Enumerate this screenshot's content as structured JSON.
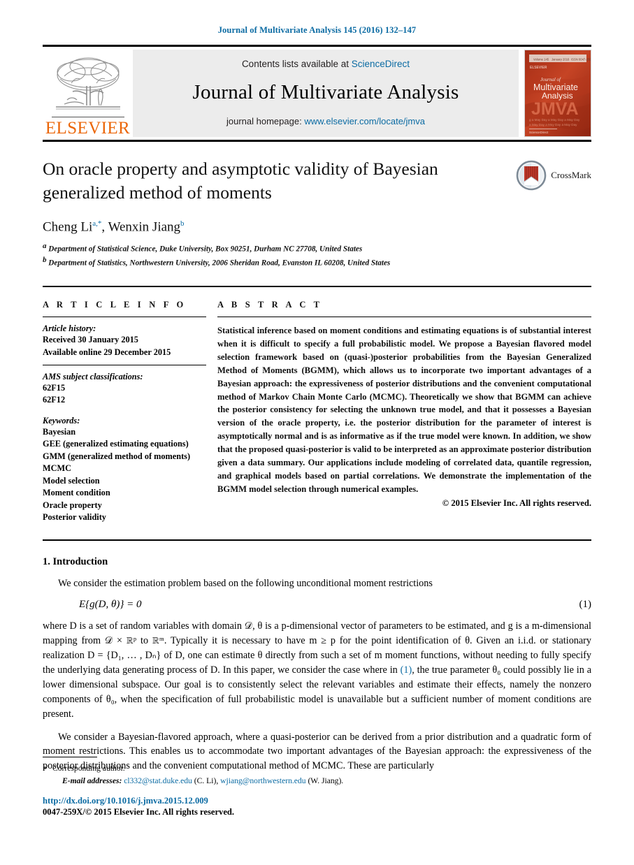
{
  "running_head": "Journal of Multivariate Analysis 145 (2016) 132–147",
  "masthead": {
    "publisher_name": "ELSEVIER",
    "contents_prefix": "Contents lists available at ",
    "contents_link": "ScienceDirect",
    "journal_title": "Journal of Multivariate Analysis",
    "homepage_prefix": "journal homepage: ",
    "homepage_link": "www.elsevier.com/locate/jmva",
    "cover": {
      "line1": "Journal of",
      "line2": "Multivariate",
      "line3": "Analysis",
      "line4": "JMVA",
      "top_left": "Volume 145",
      "top_mid": "January 2016",
      "top_right": "ISSN 0047-259X",
      "bottom": "ScienceDirect"
    }
  },
  "title": "On oracle property and asymptotic validity of Bayesian generalized method of moments",
  "authors": {
    "author1_name": "Cheng Li",
    "author1_sup": "a,*",
    "separator": ", ",
    "author2_name": "Wenxin Jiang",
    "author2_sup": "b"
  },
  "affiliations": [
    {
      "marker": "a",
      "text": "Department of Statistical Science, Duke University, Box 90251, Durham NC 27708, United States"
    },
    {
      "marker": "b",
      "text": "Department of Statistics, Northwestern University, 2006 Sheridan Road, Evanston IL 60208, United States"
    }
  ],
  "crossmark_label": "CrossMark",
  "article_info": {
    "heading": "A R T I C L E   I N F O",
    "history_label": "Article history:",
    "history": [
      "Received 30 January 2015",
      "Available online 29 December 2015"
    ],
    "ams_label": "AMS subject classifications:",
    "ams": [
      "62F15",
      "62F12"
    ],
    "keywords_label": "Keywords:",
    "keywords": [
      "Bayesian",
      "GEE (generalized estimating equations)",
      "GMM (generalized method of moments)",
      "MCMC",
      "Model selection",
      "Moment condition",
      "Oracle property",
      "Posterior validity"
    ]
  },
  "abstract": {
    "heading": "A B S T R A C T",
    "text": "Statistical inference based on moment conditions and estimating equations is of substantial interest when it is difficult to specify a full probabilistic model. We propose a Bayesian flavored model selection framework based on (quasi-)posterior probabilities from the Bayesian Generalized Method of Moments (BGMM), which allows us to incorporate two important advantages of a Bayesian approach: the expressiveness of posterior distributions and the convenient computational method of Markov Chain Monte Carlo (MCMC). Theoretically we show that BGMM can achieve the posterior consistency for selecting the unknown true model, and that it possesses a Bayesian version of the oracle property, i.e. the posterior distribution for the parameter of interest is asymptotically normal and is as informative as if the true model were known. In addition, we show that the proposed quasi-posterior is valid to be interpreted as an approximate posterior distribution given a data summary. Our applications include modeling of correlated data, quantile regression, and graphical models based on partial correlations. We demonstrate the implementation of the BGMM model selection through numerical examples.",
    "copyright": "© 2015 Elsevier Inc. All rights reserved."
  },
  "body": {
    "section_number": "1.",
    "section_title": "Introduction",
    "p1": "We consider the estimation problem based on the following unconditional moment restrictions",
    "equation": "E{g(D, θ)} = 0",
    "equation_number": "(1)",
    "p2_before_link": "where D is a set of random variables with domain 𝒟, θ is a p-dimensional vector of parameters to be estimated, and g is a m-dimensional mapping from 𝒟 × ℝᵖ to ℝᵐ. Typically it is necessary to have m ≥ p for the point identification of θ. Given an i.i.d. or stationary realization D = {D₁, … , Dₙ} of D, one can estimate θ directly from such a set of m moment functions, without needing to fully specify the underlying data generating process of D. In this paper, we consider the case where in ",
    "p2_link": "(1)",
    "p2_after_link": ", the true parameter θ₀ could possibly lie in a lower dimensional subspace. Our goal is to consistently select the relevant variables and estimate their effects, namely the nonzero components of θ₀, when the specification of full probabilistic model is unavailable but a sufficient number of moment conditions are present.",
    "p3": "We consider a Bayesian-flavored approach, where a quasi-posterior can be derived from a prior distribution and a quadratic form of moment restrictions. This enables us to accommodate two important advantages of the Bayesian approach: the expressiveness of the posterior distributions and the convenient computational method of MCMC. These are particularly"
  },
  "footer": {
    "corresponding_marker": "*",
    "corresponding_text": "Corresponding author.",
    "email_label": "E-mail addresses:",
    "email1": "cl332@stat.duke.edu",
    "email1_attr": "(C. Li),",
    "email2": "wjiang@northwestern.edu",
    "email2_attr": "(W. Jiang).",
    "doi": "http://dx.doi.org/10.1016/j.jmva.2015.12.009",
    "issn": "0047-259X/© 2015 Elsevier Inc. All rights reserved."
  },
  "colors": {
    "link_blue": "#0b6ba3",
    "science_direct_blue": "#2b7bba",
    "elsevier_orange": "#eb6608",
    "cover_orange": "#c0391c"
  }
}
